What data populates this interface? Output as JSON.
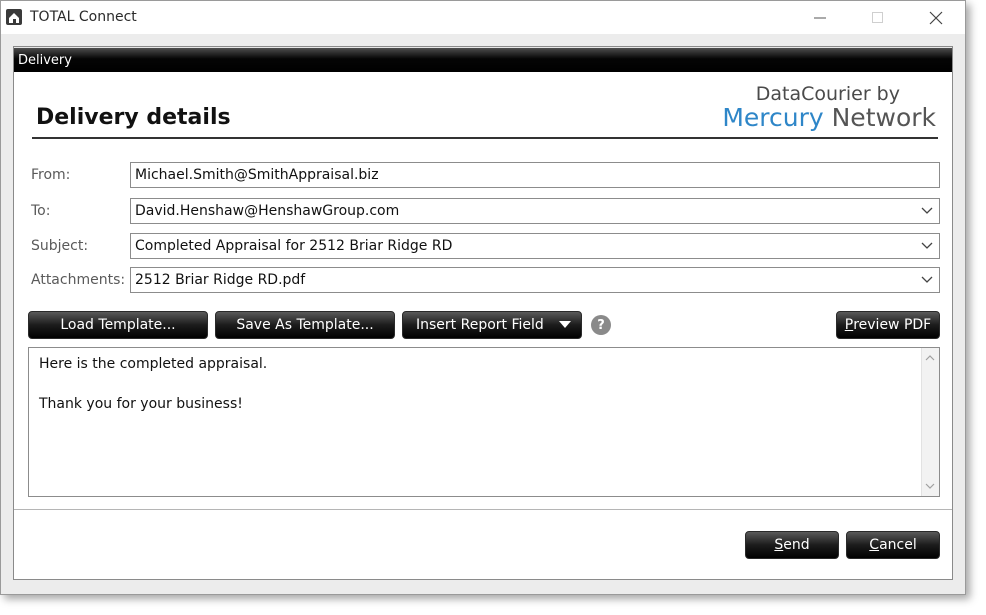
{
  "window": {
    "title": "TOTAL Connect"
  },
  "dialog": {
    "header": "Delivery",
    "title": "Delivery details",
    "logo": {
      "line1": "DataCourier by",
      "word1": "Mercury",
      "word2": "Network"
    }
  },
  "fields": {
    "from": {
      "label": "From:",
      "value": "Michael.Smith@SmithAppraisal.biz"
    },
    "to": {
      "label": "To:",
      "value": "David.Henshaw@HenshawGroup.com"
    },
    "subject": {
      "label": "Subject:",
      "value": "Completed Appraisal for 2512 Briar Ridge RD"
    },
    "attachments": {
      "label": "Attachments:",
      "value": "2512 Briar Ridge RD.pdf"
    }
  },
  "toolbar": {
    "load_template": "Load Template...",
    "save_as_template": "Save As Template...",
    "insert_report_field": "Insert Report Field",
    "help": "?",
    "preview_first": "P",
    "preview_rest": "review PDF"
  },
  "message": {
    "line1": "Here is the completed appraisal.",
    "line2": "Thank you for your business!"
  },
  "footer": {
    "send_first": "S",
    "send_rest": "end",
    "cancel_first": "C",
    "cancel_rest": "ancel"
  },
  "colors": {
    "accent": "#2e86c8",
    "button_bg": "#000000",
    "header_bg": "#000000"
  },
  "icons": [
    "app-icon",
    "minimize-icon",
    "maximize-icon",
    "close-icon",
    "chevron-down-icon",
    "help-icon",
    "caret-down-icon",
    "scroll-up-icon",
    "scroll-down-icon"
  ]
}
